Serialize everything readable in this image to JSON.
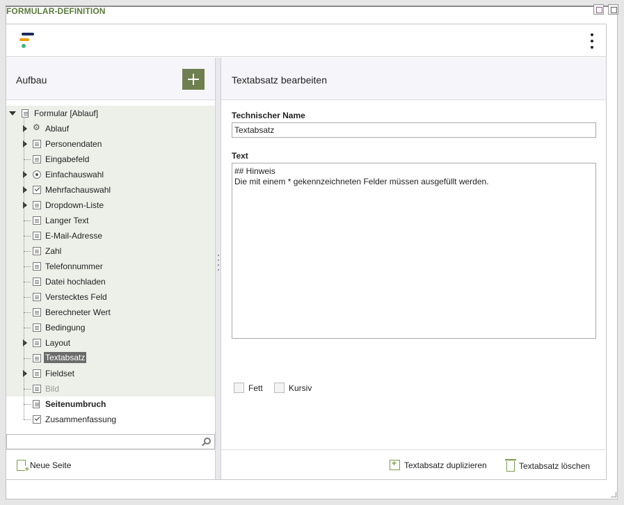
{
  "frame": {
    "title": "FORMULAR-DEFINITION"
  },
  "left": {
    "title": "Aufbau",
    "tree": [
      {
        "label": "Formular [Ablauf]",
        "icon": "form-icon",
        "level": 0,
        "expanded": true
      },
      {
        "label": "Ablauf",
        "icon": "gear-icon",
        "level": 1,
        "expandable": true
      },
      {
        "label": "Personendaten",
        "icon": "table-icon",
        "level": 1,
        "expandable": true
      },
      {
        "label": "Eingabefeld",
        "icon": "input-icon",
        "level": 1
      },
      {
        "label": "Einfachauswahl",
        "icon": "radio-icon",
        "level": 1,
        "expandable": true
      },
      {
        "label": "Mehrfachauswahl",
        "icon": "checkbox-icon",
        "level": 1,
        "expandable": true
      },
      {
        "label": "Dropdown-Liste",
        "icon": "list-icon",
        "level": 1,
        "expandable": true
      },
      {
        "label": "Langer Text",
        "icon": "textarea-icon",
        "level": 1
      },
      {
        "label": "E-Mail-Adresse",
        "icon": "email-icon",
        "level": 1
      },
      {
        "label": "Zahl",
        "icon": "number-icon",
        "level": 1
      },
      {
        "label": "Telefonnummer",
        "icon": "phone-icon",
        "level": 1
      },
      {
        "label": "Datei hochladen",
        "icon": "upload-icon",
        "level": 1
      },
      {
        "label": "Verstecktes Feld",
        "icon": "hidden-field-icon",
        "level": 1
      },
      {
        "label": "Berechneter Wert",
        "icon": "calc-icon",
        "level": 1
      },
      {
        "label": "Bedingung",
        "icon": "condition-icon",
        "level": 1
      },
      {
        "label": "Layout",
        "icon": "layout-icon",
        "level": 1,
        "expandable": true
      },
      {
        "label": "Textabsatz",
        "icon": "text-paragraph-icon",
        "level": 1,
        "selected": true
      },
      {
        "label": "Fieldset",
        "icon": "fieldset-icon",
        "level": 1,
        "expandable": true
      },
      {
        "label": "Bild",
        "icon": "image-icon",
        "level": 1,
        "disabled": true
      },
      {
        "label": "Seitenumbruch",
        "icon": "page-break-icon",
        "level": 1,
        "bold": true
      },
      {
        "label": "Zusammenfassung",
        "icon": "summary-icon",
        "level": 1
      }
    ],
    "search": {
      "value": ""
    },
    "new_page_label": "Neue Seite"
  },
  "right": {
    "title": "Textabsatz bearbeiten",
    "technical_name_label": "Technischer Name",
    "technical_name_value": "Textabsatz",
    "text_label": "Text",
    "text_value": "## Hinweis\nDie mit einem * gekennzeichneten Felder müssen ausgefüllt werden.",
    "bold_label": "Fett",
    "italic_label": "Kursiv",
    "duplicate_label": "Textabsatz duplizieren",
    "delete_label": "Textabsatz löschen"
  },
  "colors": {
    "accent_green": "#6f7f4f",
    "title_green": "#5a7a3a",
    "selected_bg": "#6b6b6b",
    "tree_bg": "#edf0e9"
  }
}
